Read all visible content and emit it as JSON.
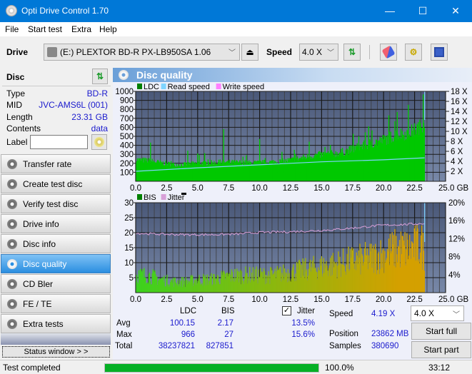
{
  "window": {
    "title": "Opti Drive Control 1.70",
    "minimize": "—",
    "maximize": "☐",
    "close": "✕"
  },
  "menu": [
    "File",
    "Start test",
    "Extra",
    "Help"
  ],
  "toolbar": {
    "drive_label": "Drive",
    "drive_value": "(E:)  PLEXTOR BD-R  PX-LB950SA 1.06",
    "speed_label": "Speed",
    "speed_value": "4.0 X"
  },
  "disc": {
    "header": "Disc",
    "type_label": "Type",
    "type_value": "BD-R",
    "mid_label": "MID",
    "mid_value": "JVC-AMS6L (001)",
    "length_label": "Length",
    "length_value": "23.31 GB",
    "contents_label": "Contents",
    "contents_value": "data",
    "label_label": "Label",
    "label_value": ""
  },
  "nav": [
    {
      "label": "Transfer rate",
      "active": false
    },
    {
      "label": "Create test disc",
      "active": false
    },
    {
      "label": "Verify test disc",
      "active": false
    },
    {
      "label": "Drive info",
      "active": false
    },
    {
      "label": "Disc info",
      "active": false
    },
    {
      "label": "Disc quality",
      "active": true
    },
    {
      "label": "CD Bler",
      "active": false
    },
    {
      "label": "FE / TE",
      "active": false
    },
    {
      "label": "Extra tests",
      "active": false
    }
  ],
  "status_window_label": "Status window > >",
  "panel_title": "Disc quality",
  "colors": {
    "ldc": "#00c800",
    "read_speed": "#7fd4ff",
    "write_speed": "#ff80ff",
    "bis_low": "#3cd21e",
    "bis_high": "#d4a000",
    "jitter": "#d8a0d8",
    "plot_bg_top": "#4a5878",
    "plot_bg_bottom": "#7888a8"
  },
  "chart_data": [
    {
      "type": "area",
      "title": "LDC",
      "legend": [
        "LDC",
        "Read speed",
        "Write speed"
      ],
      "x_ticks": [
        "0.0",
        "2.5",
        "5.0",
        "7.5",
        "10.0",
        "12.5",
        "15.0",
        "17.5",
        "20.0",
        "22.5",
        "25.0 GB"
      ],
      "xlim": [
        0,
        25
      ],
      "y_ticks": [
        "100",
        "200",
        "300",
        "400",
        "500",
        "600",
        "700",
        "800",
        "900",
        "1000"
      ],
      "ylim": [
        0,
        1000
      ],
      "y2_ticks": [
        "2 X",
        "4 X",
        "6 X",
        "8 X",
        "10 X",
        "12 X",
        "14 X",
        "16 X",
        "18 X"
      ],
      "y2lim": [
        0,
        18
      ],
      "ldc_envelope": {
        "x": [
          0,
          1,
          2,
          3,
          4,
          5,
          6,
          7,
          8,
          9,
          10,
          11,
          12,
          13,
          14,
          15,
          16,
          17,
          18,
          19,
          20,
          21,
          22,
          23,
          23.31
        ],
        "y": [
          250,
          240,
          215,
          195,
          195,
          210,
          215,
          220,
          220,
          215,
          215,
          225,
          235,
          260,
          290,
          310,
          320,
          350,
          400,
          440,
          480,
          540,
          560,
          640,
          700
        ]
      },
      "ldc_spikes": [
        {
          "x": 1.2,
          "y": 430
        },
        {
          "x": 4.2,
          "y": 340
        },
        {
          "x": 5.0,
          "y": 310
        },
        {
          "x": 7.1,
          "y": 580
        },
        {
          "x": 10.0,
          "y": 470
        },
        {
          "x": 12.8,
          "y": 350
        },
        {
          "x": 14.0,
          "y": 440
        },
        {
          "x": 18.0,
          "y": 500
        },
        {
          "x": 21.1,
          "y": 770
        },
        {
          "x": 22.0,
          "y": 850
        },
        {
          "x": 23.2,
          "y": 966
        }
      ],
      "read_speed": {
        "x": [
          0,
          5,
          10,
          15,
          20,
          23.31
        ],
        "y": [
          2.0,
          2.7,
          3.3,
          3.9,
          4.3,
          4.7
        ]
      }
    },
    {
      "type": "area",
      "title": "BIS / Jitter",
      "legend": [
        "BIS",
        "Jitter"
      ],
      "x_ticks": [
        "0.0",
        "2.5",
        "5.0",
        "7.5",
        "10.0",
        "12.5",
        "15.0",
        "17.5",
        "20.0",
        "22.5",
        "25.0 GB"
      ],
      "xlim": [
        0,
        25
      ],
      "y_ticks": [
        "5",
        "10",
        "15",
        "20",
        "25",
        "30"
      ],
      "ylim": [
        0,
        30
      ],
      "y2_ticks": [
        "4%",
        "8%",
        "12%",
        "16%",
        "20%"
      ],
      "y2lim": [
        0,
        20
      ],
      "bis_envelope": {
        "x": [
          0,
          1,
          2,
          3,
          4,
          5,
          6,
          7,
          8,
          9,
          10,
          11,
          12,
          13,
          14,
          15,
          16,
          17,
          18,
          19,
          20,
          21,
          22,
          23,
          23.31
        ],
        "y": [
          8,
          8,
          6,
          5,
          5,
          6,
          6,
          7,
          8,
          8,
          8,
          8,
          9,
          10,
          11,
          12,
          13,
          14,
          15,
          16,
          18,
          20,
          20,
          22,
          18
        ]
      },
      "jitter": {
        "x": [
          0,
          2,
          4,
          6,
          8,
          10,
          12,
          14,
          16,
          18,
          20,
          22,
          23.31
        ],
        "y": [
          13.2,
          13.0,
          12.9,
          12.9,
          13.0,
          13.4,
          13.5,
          13.7,
          14.0,
          14.5,
          15.0,
          15.2,
          15.4
        ]
      }
    }
  ],
  "stats": {
    "col_ldc": "LDC",
    "col_bis": "BIS",
    "jitter_label": "Jitter",
    "jitter_checked": true,
    "avg_label": "Avg",
    "avg_ldc": "100.15",
    "avg_bis": "2.17",
    "avg_jitter": "13.5%",
    "max_label": "Max",
    "max_ldc": "966",
    "max_bis": "27",
    "max_jitter": "15.6%",
    "total_label": "Total",
    "total_ldc": "38237821",
    "total_bis": "827851",
    "speed_label": "Speed",
    "speed_value": "4.19 X",
    "position_label": "Position",
    "position_value": "23862 MB",
    "samples_label": "Samples",
    "samples_value": "380690",
    "speed_select": "4.0 X",
    "start_full": "Start full",
    "start_part": "Start part"
  },
  "statusbar": {
    "text": "Test completed",
    "progress": 100.0,
    "progress_text": "100.0%",
    "time": "33:12"
  }
}
